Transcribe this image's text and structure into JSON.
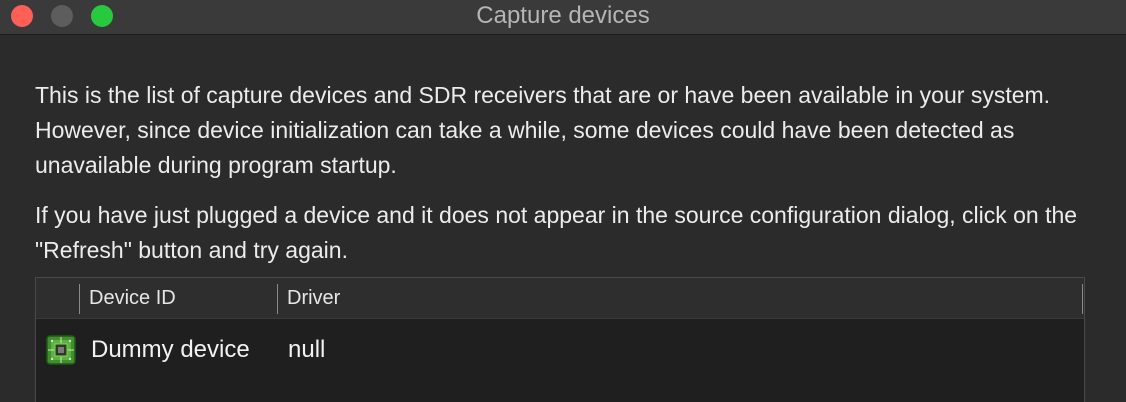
{
  "window": {
    "title": "Capture devices"
  },
  "content": {
    "paragraph_1": "This is the list of capture devices and SDR receivers that are or have been available in your system. However, since device initialization can take a while, some devices could have been detected as unavailable during program startup.",
    "paragraph_2": "If you have just plugged a device and it does not appear in the source configuration dialog, click on the \"Refresh\" button and try again."
  },
  "table": {
    "columns": [
      "Device ID",
      "Driver"
    ],
    "rows": [
      {
        "icon": "device-chip-icon",
        "device_id": "Dummy device",
        "driver": "null"
      }
    ]
  },
  "colors": {
    "close": "#fe5f57",
    "minimize": "#5d5d5d",
    "zoom": "#27c93f"
  }
}
